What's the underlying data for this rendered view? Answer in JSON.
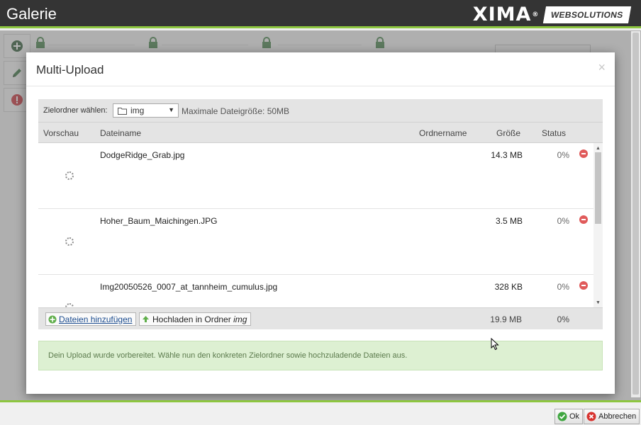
{
  "app": {
    "title": "Galerie",
    "brand_name": "XIMA",
    "brand_reg": "®",
    "brand_tag": "WEBSOLUTIONS"
  },
  "icons": {
    "add": "plus-circle-icon",
    "edit": "pencil-icon",
    "alert": "exclamation-icon",
    "lock": "lock-icon",
    "folder": "folder-icon",
    "spinner": "spinner-icon",
    "delete": "minus-circle-icon"
  },
  "colors": {
    "topbar": "#343434",
    "accent": "#8dc63f",
    "danger": "#e05a5a",
    "link": "#1a4b8e",
    "notice_bg": "#ddf0d2",
    "notice_text": "#5b7a4c"
  },
  "modal": {
    "title": "Multi-Upload",
    "close": "×",
    "toolbar": {
      "target_label": "Zielordner wählen:",
      "folder_value": "img",
      "max_size": "Maximale Dateigröße: 50MB"
    },
    "columns": {
      "preview": "Vorschau",
      "filename": "Dateiname",
      "folder": "Ordnername",
      "size": "Größe",
      "status": "Status"
    },
    "files": [
      {
        "name": "DodgeRidge_Grab.jpg",
        "size": "14.3 MB",
        "status": "0%"
      },
      {
        "name": "Hoher_Baum_Maichingen.JPG",
        "size": "3.5 MB",
        "status": "0%"
      },
      {
        "name": "Img20050526_0007_at_tannheim_cumulus.jpg",
        "size": "328 KB",
        "status": "0%"
      }
    ],
    "footer": {
      "add_files": "Dateien hinzufügen",
      "upload_prefix": "Hochladen in Ordner",
      "upload_folder": "img",
      "total_size": "19.9 MB",
      "total_status": "0%"
    },
    "notice": "Dein Upload wurde vorbereitet. Wähle nun den konkreten Zielordner sowie hochzuladende Dateien aus."
  },
  "bottom": {
    "ok": "Ok",
    "cancel": "Abbrechen"
  }
}
